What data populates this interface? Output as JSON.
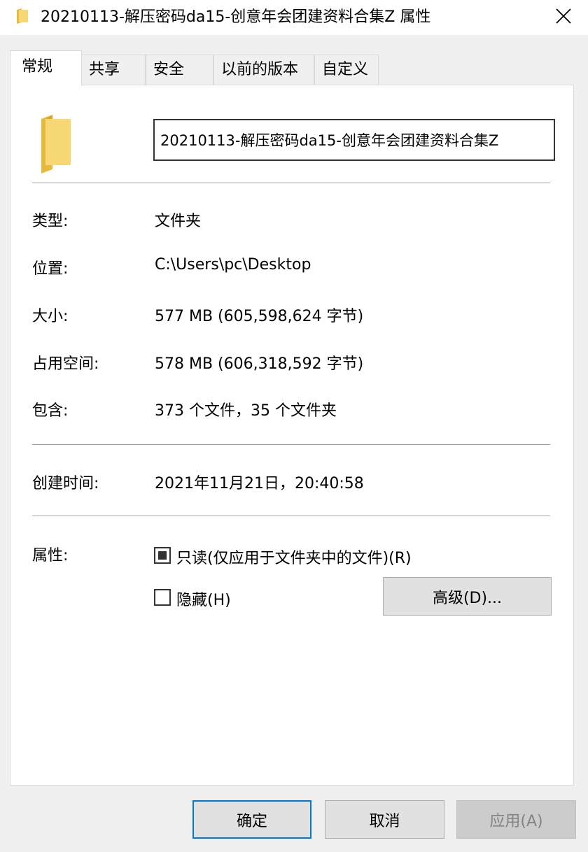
{
  "window": {
    "title": "20210113-解压密码da15-创意年会团建资料合集Z 属性",
    "close_icon": "close-icon"
  },
  "tabs": [
    {
      "label": "常规",
      "active": true
    },
    {
      "label": "共享"
    },
    {
      "label": "安全"
    },
    {
      "label": "以前的版本"
    },
    {
      "label": "自定义"
    }
  ],
  "general": {
    "folder_name": "20210113-解压密码da15-创意年会团建资料合集Z",
    "type_label": "类型:",
    "type_value": "文件夹",
    "location_label": "位置:",
    "location_value": "C:\\Users\\pc\\Desktop",
    "size_label": "大小:",
    "size_value": "577 MB (605,598,624 字节)",
    "disk_size_label": "占用空间:",
    "disk_size_value": "578 MB (606,318,592 字节)",
    "contains_label": "包含:",
    "contains_value": "373 个文件，35 个文件夹",
    "created_label": "创建时间:",
    "created_value": "2021年11月21日，20:40:58",
    "attributes_label": "属性:",
    "readonly_label": "只读(仅应用于文件夹中的文件)(R)",
    "readonly_state": "indeterminate",
    "hidden_label": "隐藏(H)",
    "hidden_state": "unchecked",
    "advanced_label": "高级(D)..."
  },
  "buttons": {
    "ok": "确定",
    "cancel": "取消",
    "apply": "应用(A)"
  },
  "colors": {
    "folder_yellow": "#f8d775",
    "folder_dark": "#e8b93a",
    "focus_blue": "#0078d7"
  }
}
